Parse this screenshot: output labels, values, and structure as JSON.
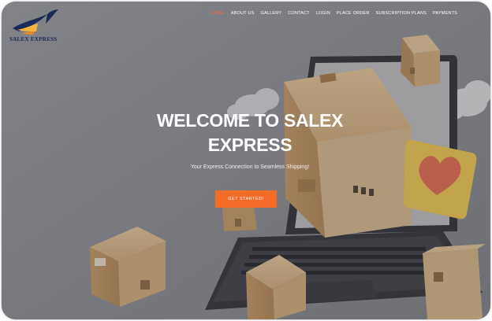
{
  "brand": {
    "name": "SALEX EXPRESS"
  },
  "nav": {
    "items": [
      "HOME",
      "ABOUT US",
      "GALLERY",
      "CONTACT",
      "LOGIN",
      "PLACE ORDER",
      "SUBSCRIPTION PLANS",
      "PAYMENTS"
    ],
    "active": "HOME"
  },
  "hero": {
    "title_line1": "WELCOME TO SALEX",
    "title_line2": "EXPRESS",
    "subtitle": "Your Express Connection to Seamless Shipping!",
    "cta_label": "GET STARTED!"
  },
  "colors": {
    "accent": "#f36b24",
    "brand_navy": "#1b2a5a",
    "background": "#8c8e92"
  },
  "icons": [
    "logo-bird-icon",
    "heart-icon"
  ]
}
